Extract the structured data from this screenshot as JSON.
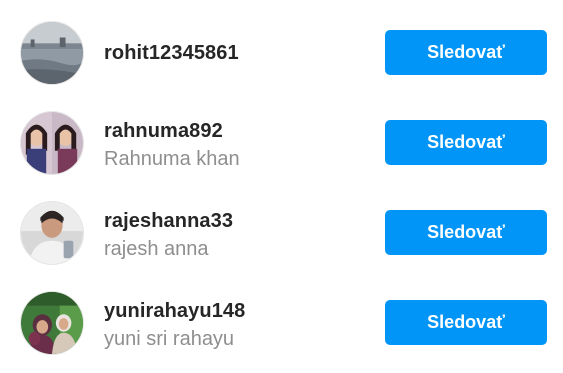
{
  "suggestions": [
    {
      "username": "rohit12345861",
      "full_name": "",
      "button_label": "Sledovať",
      "avatar": "lake-photo"
    },
    {
      "username": "rahnuma892",
      "full_name": "Rahnuma khan",
      "button_label": "Sledovať",
      "avatar": "two-girls-photo"
    },
    {
      "username": "rajeshanna33",
      "full_name": "rajesh anna",
      "button_label": "Sledovať",
      "avatar": "selfie-photo"
    },
    {
      "username": "yunirahayu148",
      "full_name": "yuni sri rahayu",
      "button_label": "Sledovať",
      "avatar": "group-photo"
    }
  ],
  "colors": {
    "button": "#0095f6",
    "username": "#262626",
    "full_name": "#8e8e8e"
  }
}
